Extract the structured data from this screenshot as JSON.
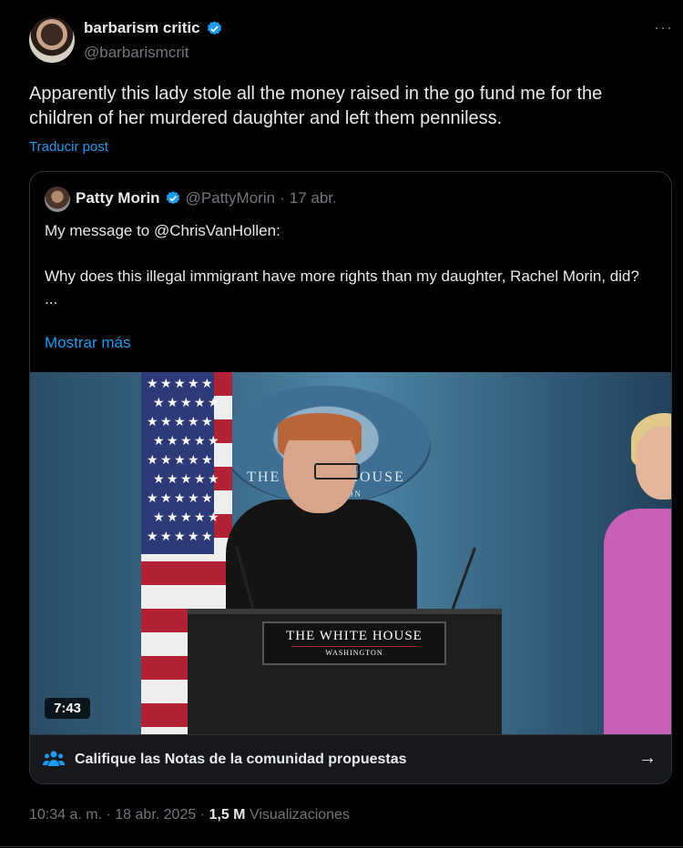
{
  "post": {
    "display_name": "barbarism critic",
    "handle": "@barbarismcrit",
    "more_icon": "···",
    "text": "Apparently this lady stole all the money raised in the go fund me for the children of her murdered daughter and left them penniless.",
    "translate_label": "Traducir post"
  },
  "quote": {
    "display_name": "Patty Morin",
    "handle": "@PattyMorin",
    "separator": "·",
    "date": "17 abr.",
    "line1": "My message to @ChrisVanHollen:",
    "line2": "Why does this illegal immigrant have more rights than my daughter, Rachel Morin, did?",
    "line3": "...",
    "show_more_label": "Mostrar más",
    "video": {
      "duration": "7:43",
      "backdrop_text": "THE WHITE HOUSE",
      "backdrop_sub": "WASHINGTON",
      "sign_title": "THE WHITE HOUSE",
      "sign_subtitle": "WASHINGTON"
    },
    "notes_bar": {
      "label": "Califique las Notas de la comunidad propuestas",
      "icon": "people-icon",
      "arrow": "→"
    }
  },
  "meta": {
    "time": "10:34 a. m.",
    "sep1": "·",
    "date": "18 abr. 2025",
    "sep2": "·",
    "views_count": "1,5 M",
    "views_label": "Visualizaciones"
  },
  "colors": {
    "background": "#000000",
    "text_primary": "#e7e9ea",
    "text_secondary": "#71767b",
    "link": "#1d9bf0",
    "border": "#2f3336"
  }
}
